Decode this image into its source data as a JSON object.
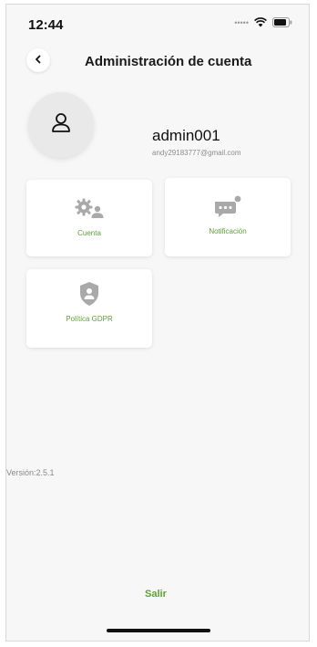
{
  "status_bar": {
    "time": "12:44",
    "signal_icon": "signal-dots",
    "wifi_icon": "wifi",
    "battery_icon": "battery"
  },
  "header": {
    "back_icon": "chevron-left",
    "title": "Administración de cuenta"
  },
  "profile": {
    "avatar_icon": "user-outline",
    "username": "admin001",
    "email": "andy29183777@gmail.com"
  },
  "cards": [
    {
      "label": "Cuenta",
      "icon": "gears-user"
    },
    {
      "label": "Notificación",
      "icon": "chat-bubble-dot"
    },
    {
      "label": "Política GDPR",
      "icon": "shield-user"
    }
  ],
  "version": "Versión:2.5.1",
  "logout_label": "Salir",
  "colors": {
    "accent": "#5ea13a",
    "icon_gray": "#a9a9a9",
    "background": "#f7f7f7",
    "card": "#ffffff"
  }
}
